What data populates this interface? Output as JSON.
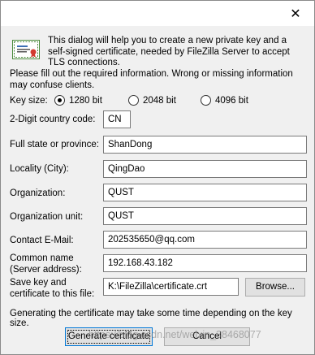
{
  "titlebar": {
    "close_glyph": "✕"
  },
  "intro_text": "This dialog will help you to create a new private key and a self-signed certificate, needed by FileZilla Server to accept TLS connections.",
  "note_text": "Please fill out the required information. Wrong or missing information may confuse clients.",
  "key_size": {
    "label": "Key size:",
    "options": [
      "1280 bit",
      "2048 bit",
      "4096 bit"
    ],
    "selected": "1280 bit"
  },
  "fields": {
    "country": {
      "label": "2-Digit country code:",
      "value": "CN"
    },
    "state": {
      "label": "Full state or province:",
      "value": "ShanDong"
    },
    "locality": {
      "label": "Locality (City):",
      "value": "QingDao"
    },
    "org": {
      "label": "Organization:",
      "value": "QUST"
    },
    "org_unit": {
      "label": "Organization unit:",
      "value": "QUST"
    },
    "email": {
      "label": "Contact E-Mail:",
      "value": "202535650@qq.com"
    },
    "common": {
      "label_line1": "Common name",
      "label_line2": "(Server address):",
      "value": "192.168.43.182"
    },
    "save_path": {
      "label_line1": "Save key and",
      "label_line2": "certificate to this file:",
      "value": "K:\\FileZilla\\certificate.crt"
    }
  },
  "browse_label": "Browse...",
  "footnote": "Generating the certificate may take some time depending on the key size.",
  "generate_label": "Generate certificate",
  "cancel_label": "Cancel",
  "watermark": "https://blog.csdn.net/weixin_38468077"
}
